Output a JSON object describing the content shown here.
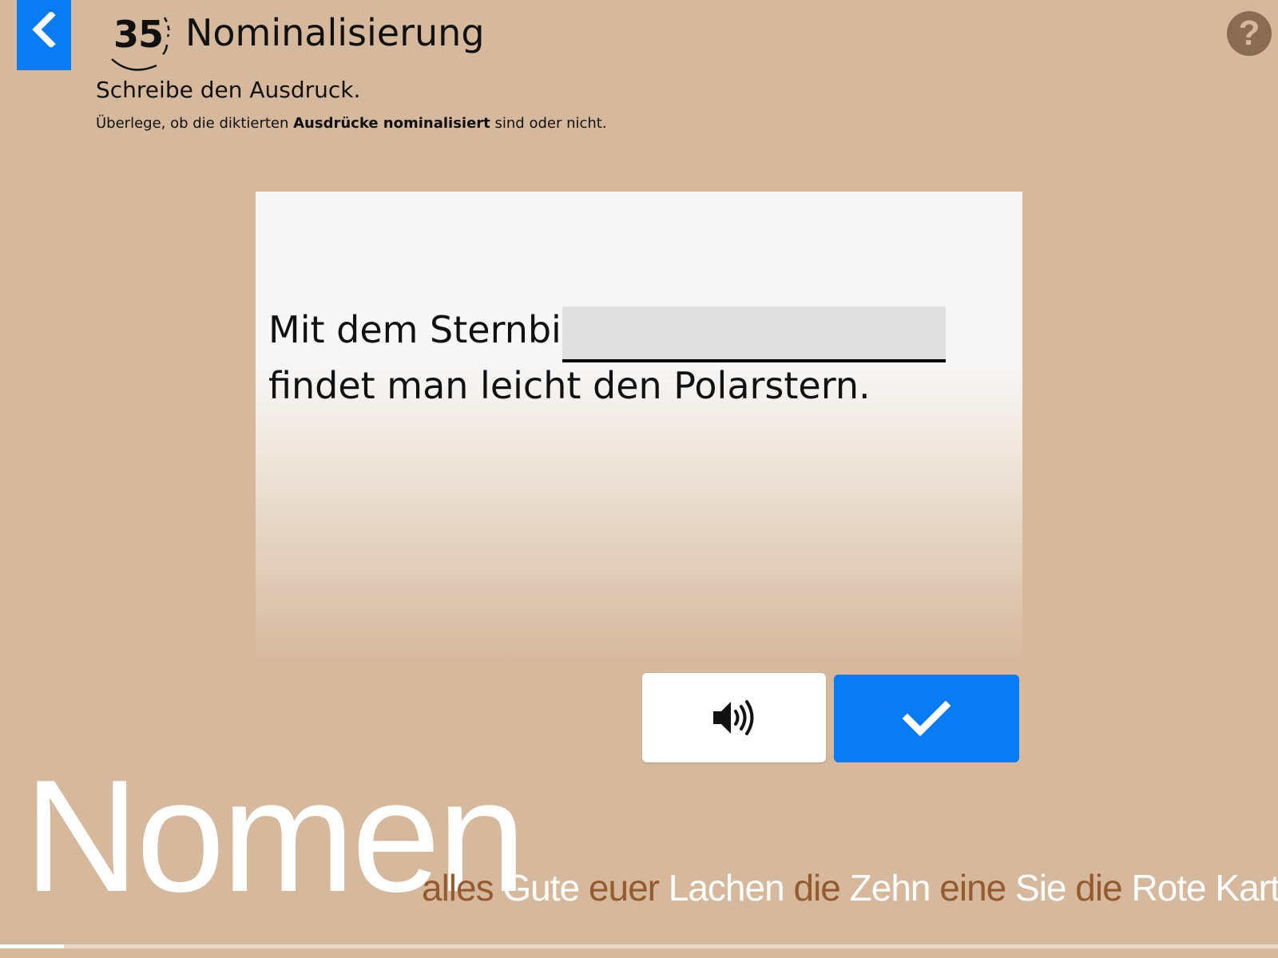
{
  "header": {
    "exercise_number": "35",
    "title": "Nominalisierung",
    "instruction": "Schreibe den Ausdruck.",
    "hint_prefix": "Überlege, ob die diktierten ",
    "hint_bold": "Ausdrücke nominalisiert",
    "hint_suffix": " sind oder nicht."
  },
  "icons": {
    "back": "chevron-left-icon",
    "help": "question-mark-icon",
    "audio": "speaker-icon",
    "check": "checkmark-icon"
  },
  "help": {
    "label": "?"
  },
  "exercise": {
    "sentence_before": "Mit dem Sternbild",
    "answer_value": "",
    "sentence_after": "findet man leicht den Polarstern."
  },
  "footer": {
    "big_word": "Nomen",
    "ticker": [
      {
        "text": "alles",
        "style": "c"
      },
      {
        "text": "Gute",
        "style": "w"
      },
      {
        "text": "euer",
        "style": "c"
      },
      {
        "text": "Lachen",
        "style": "w"
      },
      {
        "text": "die",
        "style": "c"
      },
      {
        "text": "Zehn",
        "style": "w"
      },
      {
        "text": "eine",
        "style": "c"
      },
      {
        "text": "Sie",
        "style": "w"
      },
      {
        "text": "die",
        "style": "c"
      },
      {
        "text": "Rote Karte",
        "style": "w"
      }
    ],
    "progress": 0.05
  },
  "colors": {
    "background": "#d6b89c",
    "accent": "#0a7cf3",
    "ticker_accent": "#965a2f"
  }
}
